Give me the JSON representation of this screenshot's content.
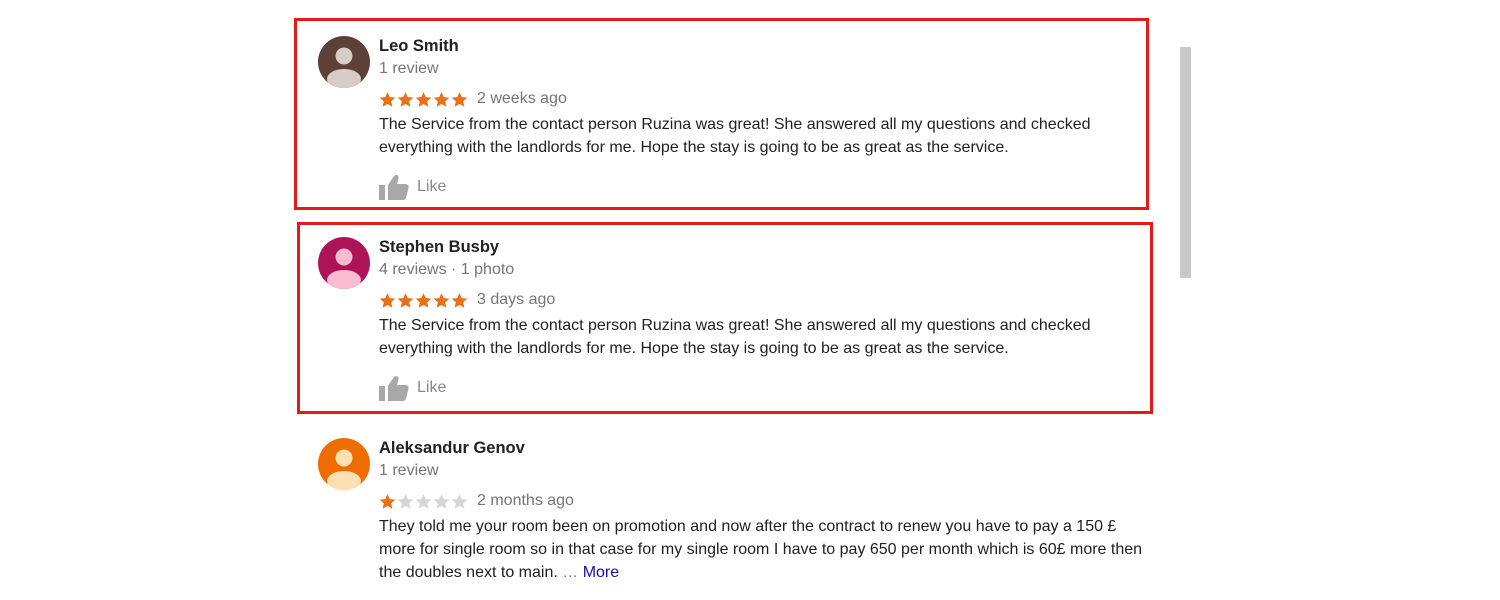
{
  "reviews": [
    {
      "name": "Leo Smith",
      "meta": "1 review",
      "rating": 5,
      "date": "2 weeks ago",
      "text": "The Service from the contact person Ruzina was great! She answered all my questions and checked everything with the landlords for me. Hope the stay is going to be as great as the service.",
      "like_label": "Like",
      "avatar_color": "#5d4037",
      "avatar_figure_color": "#d7ccc8"
    },
    {
      "name": "Stephen Busby",
      "meta": "4 reviews · 1 photo",
      "rating": 5,
      "date": "3 days ago",
      "text": "The Service from the contact person Ruzina was great! She answered all my questions and checked everything with the landlords for me. Hope the stay is going to be as great as the service.",
      "like_label": "Like",
      "avatar_color": "#ad1457",
      "avatar_figure_color": "#f8bbd0"
    },
    {
      "name": "Aleksandur Genov",
      "meta": "1 review",
      "rating": 1,
      "date": "2 months ago",
      "text": "They told me your room been on promotion and now after the contract to renew you have to pay a 150 £ more for single room so in that case for my single room I have to pay 650 per month which is 60£ more then the doubles next to main.",
      "ellipsis": "…",
      "more_label": "More",
      "avatar_color": "#ef6c00",
      "avatar_figure_color": "#ffe0b2"
    }
  ],
  "colors": {
    "star_filled": "#e7711b",
    "star_empty": "#d6d6d6",
    "highlight": "#e31b1b",
    "like_icon": "#a8a8a8"
  },
  "icons": {
    "star": "star-icon",
    "like": "thumbs-up-icon",
    "avatar": "person-icon"
  }
}
